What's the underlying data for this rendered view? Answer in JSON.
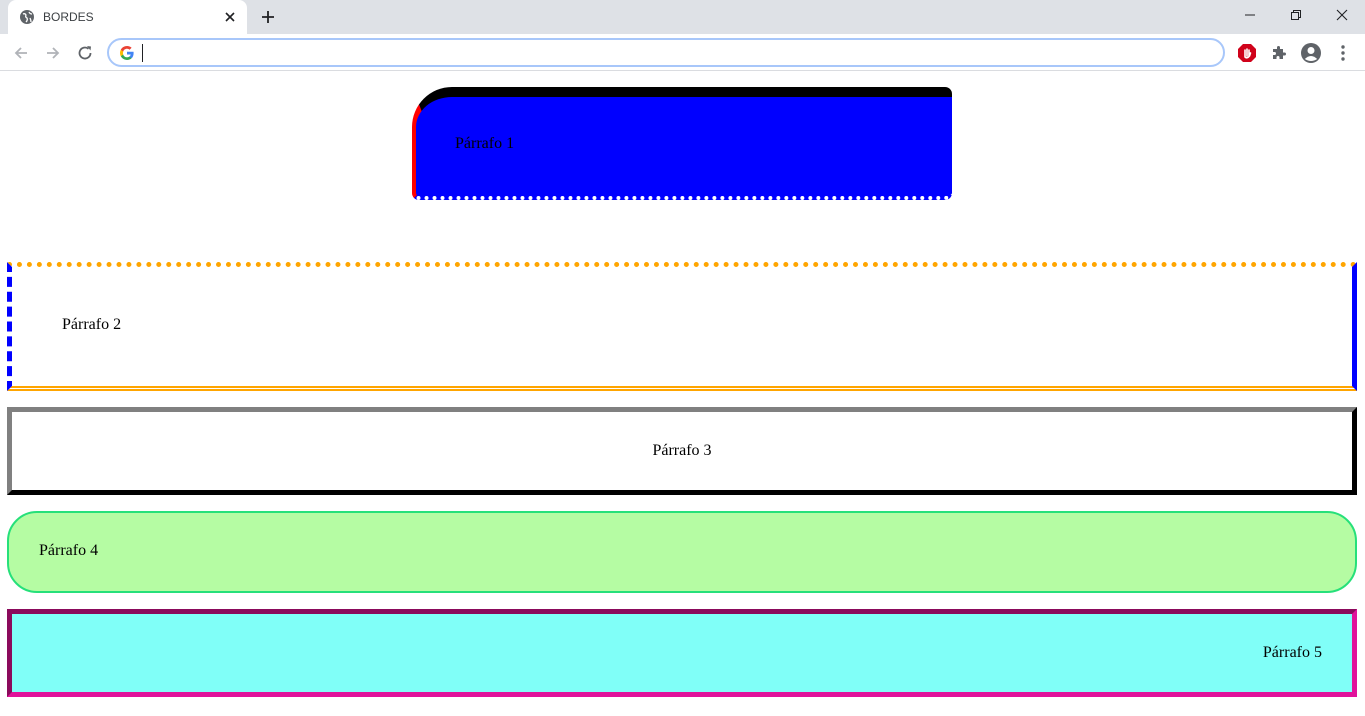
{
  "browser": {
    "tab_title": "BORDES",
    "address_value": "",
    "icons": {
      "favicon": "globe-icon",
      "tab_close": "close-icon",
      "new_tab": "plus-icon",
      "back": "arrow-left-icon",
      "forward": "arrow-right-icon",
      "reload": "reload-icon",
      "search_engine": "google-g-icon",
      "adblock": "adblock-hand-icon",
      "extensions": "puzzle-icon",
      "profile": "profile-icon",
      "menu": "kebab-menu-icon",
      "minimize": "minimize-icon",
      "restore": "restore-icon",
      "close_window": "close-icon"
    }
  },
  "page": {
    "paragraphs": [
      {
        "text": "Párrafo 1",
        "background": "#0000ff",
        "border_colors": [
          "#000000",
          "#ff0000",
          "#ffffff"
        ]
      },
      {
        "text": "Párrafo 2",
        "background": "#ffffff",
        "border_colors": [
          "#ffa500",
          "#0000ff"
        ]
      },
      {
        "text": "Párrafo 3",
        "background": "#ffffff",
        "border_colors": [
          "#808080",
          "#2b2b2b"
        ]
      },
      {
        "text": "Párrafo 4",
        "background": "#b5fca3",
        "border_colors": [
          "#26e07a"
        ]
      },
      {
        "text": "Párrafo 5",
        "background": "#80fff8",
        "border_colors": [
          "#8b0a5c",
          "#e0139a"
        ]
      }
    ]
  }
}
